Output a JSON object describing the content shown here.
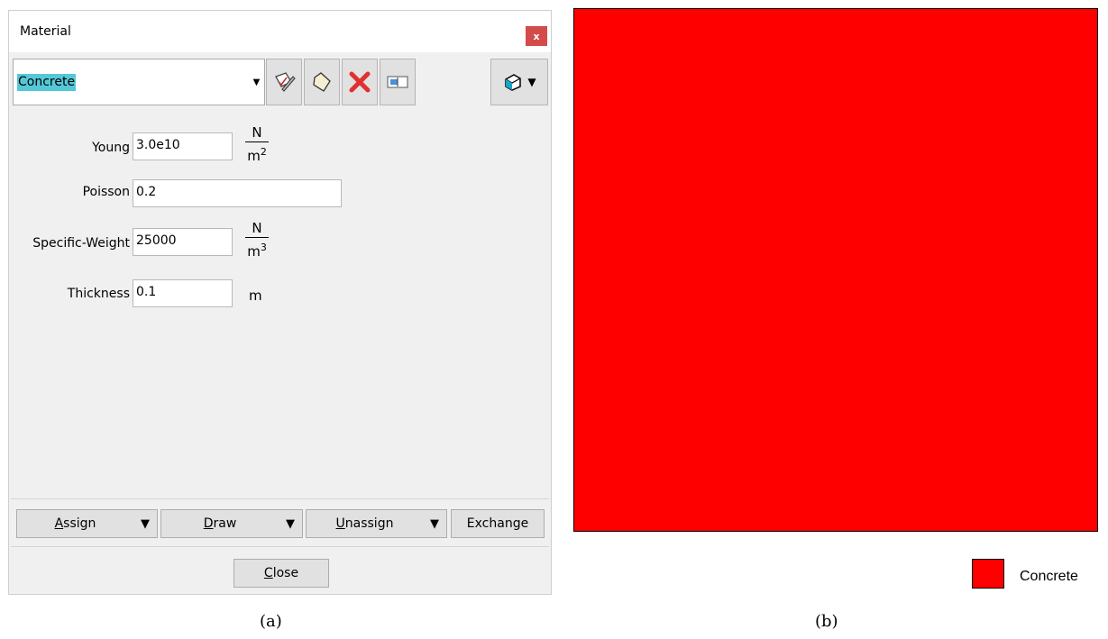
{
  "dialog": {
    "title": "Material",
    "close_glyph": "x",
    "material_select": {
      "selected": "Concrete",
      "arrow_icon": "chevron-down-icon"
    },
    "toolbar": [
      {
        "icon": "edit-material-icon"
      },
      {
        "icon": "new-material-icon"
      },
      {
        "icon": "delete-icon"
      },
      {
        "icon": "rename-icon"
      },
      {
        "icon": "view-options-icon"
      }
    ],
    "fields": [
      {
        "label": "Young",
        "value": "3.0e10",
        "unit_num": "N",
        "unit_den": "m",
        "unit_exp": "2"
      },
      {
        "label": "Poisson",
        "value": "0.2"
      },
      {
        "label": "Specific-Weight",
        "value": "25000",
        "unit_num": "N",
        "unit_den": "m",
        "unit_exp": "3"
      },
      {
        "label": "Thickness",
        "value": "0.1",
        "unit": "m"
      }
    ],
    "actions": {
      "assign": "Assign",
      "draw": "Draw",
      "unassign": "Unassign",
      "exchange": "Exchange",
      "close": "Close"
    }
  },
  "captions": {
    "a": "(a)",
    "b": "(b)"
  },
  "plot": {
    "fill_color": "#ff0000",
    "legend": [
      {
        "label": "Concrete",
        "color": "#ff0000"
      }
    ]
  }
}
